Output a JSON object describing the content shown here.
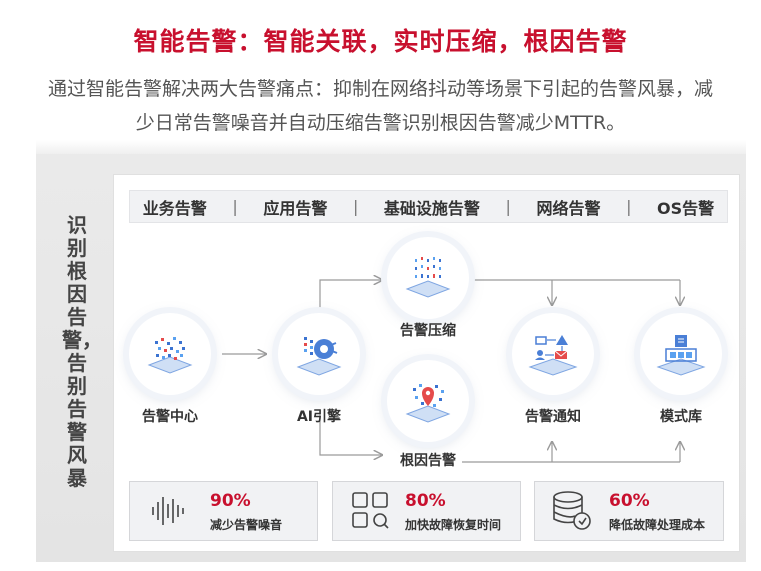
{
  "header": {
    "title": "智能告警：智能关联，实时压缩，根因告警",
    "subtitle": "通过智能告警解决两大告警痛点：抑制在网络抖动等场景下引起的告警风暴，减少日常告警噪音并自动压缩告警识别根因告警减少MTTR。"
  },
  "side_label": "识别根因告警，告别告警风暴",
  "categories": [
    "业务告警",
    "应用告警",
    "基础设施告警",
    "网络告警",
    "OS告警"
  ],
  "category_separator": "|",
  "nodes": {
    "alarm_center": "告警中心",
    "ai_engine": "AI引擎",
    "compression": "告警压缩",
    "root_cause": "根因告警",
    "notification": "告警通知",
    "pattern_lib": "模式库"
  },
  "stats": [
    {
      "value": "90%",
      "label": "减少告警噪音",
      "icon": "waveform-icon"
    },
    {
      "value": "80%",
      "label": "加快故障恢复时间",
      "icon": "tools-grid-icon"
    },
    {
      "value": "60%",
      "label": "降低故障处理成本",
      "icon": "database-icon"
    }
  ],
  "colors": {
    "accent": "#c8102e",
    "node_blue": "#4a7fd6",
    "arrow": "#9a9a9a"
  }
}
